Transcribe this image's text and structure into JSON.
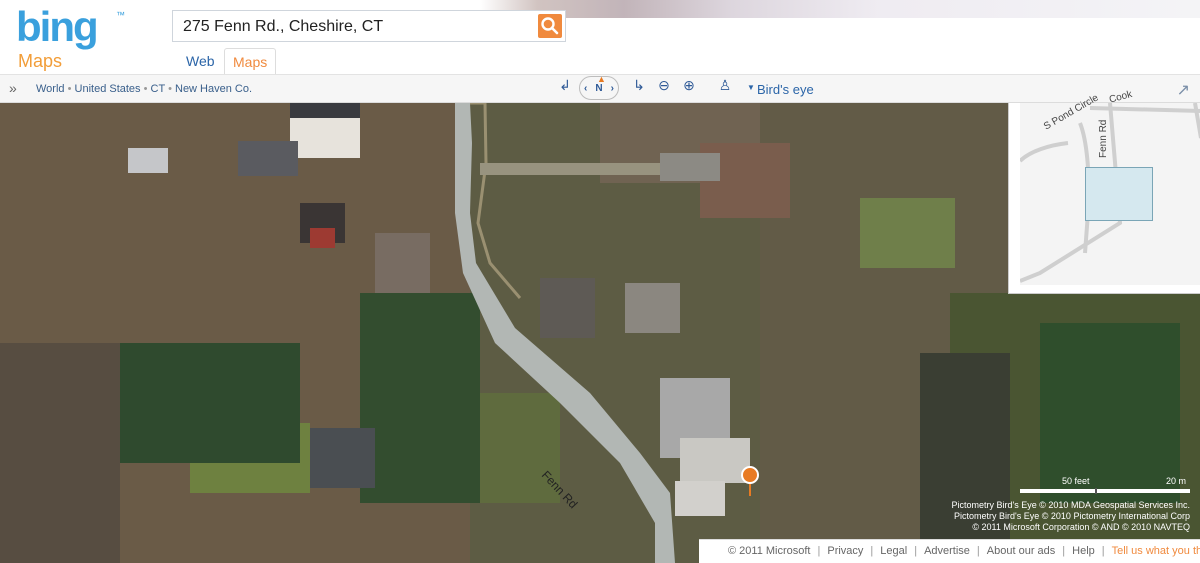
{
  "header": {
    "logo_text": "bing",
    "logo_mark": "™",
    "product": "Maps",
    "search_value": "275 Fenn Rd., Cheshire, CT",
    "tabs": [
      {
        "label": "Web"
      },
      {
        "label": "Maps"
      }
    ],
    "accent_color": "#f08a3e",
    "brand_color": "#3aa0dd"
  },
  "toolbar": {
    "expand_icon": "double-chevron-right-icon",
    "breadcrumb": [
      "World",
      "United States",
      "CT",
      "New Haven Co."
    ],
    "compass_label": "N",
    "view_mode": "Bird's eye"
  },
  "map": {
    "road_label": "Fenn Rd",
    "minimap": {
      "road_label": "Fenn Rd",
      "circle_label": "S Pond Circle",
      "top_label": "Cook"
    },
    "scale": {
      "feet": "50 feet",
      "meters": "20 m"
    },
    "attribution": [
      "Pictometry Bird's Eye © 2010 MDA Geospatial Services Inc.",
      "Pictometry Bird's Eye © 2010 Pictometry International Corp",
      "© 2011 Microsoft Corporation  © AND  © 2010 NAVTEQ"
    ]
  },
  "footer": {
    "copyright": "© 2011 Microsoft",
    "links": [
      "Privacy",
      "Legal",
      "Advertise",
      "About our ads",
      "Help"
    ],
    "feedback": "Tell us what you think"
  }
}
